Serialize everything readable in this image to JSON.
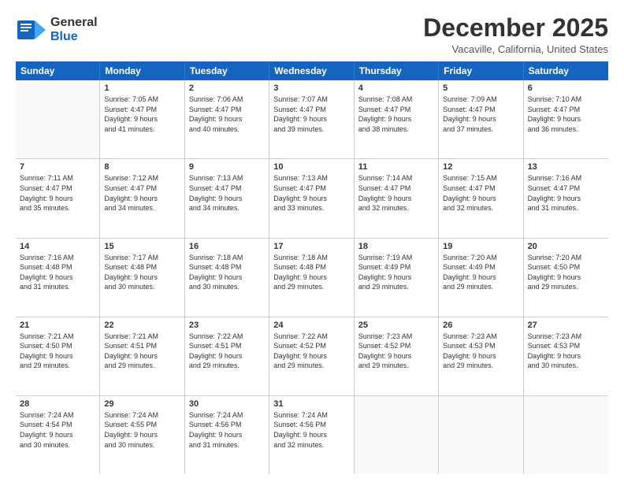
{
  "header": {
    "logo_line1": "General",
    "logo_line2": "Blue",
    "month": "December 2025",
    "location": "Vacaville, California, United States"
  },
  "weekdays": [
    "Sunday",
    "Monday",
    "Tuesday",
    "Wednesday",
    "Thursday",
    "Friday",
    "Saturday"
  ],
  "rows": [
    [
      {
        "day": "",
        "info": ""
      },
      {
        "day": "1",
        "info": "Sunrise: 7:05 AM\nSunset: 4:47 PM\nDaylight: 9 hours\nand 41 minutes."
      },
      {
        "day": "2",
        "info": "Sunrise: 7:06 AM\nSunset: 4:47 PM\nDaylight: 9 hours\nand 40 minutes."
      },
      {
        "day": "3",
        "info": "Sunrise: 7:07 AM\nSunset: 4:47 PM\nDaylight: 9 hours\nand 39 minutes."
      },
      {
        "day": "4",
        "info": "Sunrise: 7:08 AM\nSunset: 4:47 PM\nDaylight: 9 hours\nand 38 minutes."
      },
      {
        "day": "5",
        "info": "Sunrise: 7:09 AM\nSunset: 4:47 PM\nDaylight: 9 hours\nand 37 minutes."
      },
      {
        "day": "6",
        "info": "Sunrise: 7:10 AM\nSunset: 4:47 PM\nDaylight: 9 hours\nand 36 minutes."
      }
    ],
    [
      {
        "day": "7",
        "info": "Sunrise: 7:11 AM\nSunset: 4:47 PM\nDaylight: 9 hours\nand 35 minutes."
      },
      {
        "day": "8",
        "info": "Sunrise: 7:12 AM\nSunset: 4:47 PM\nDaylight: 9 hours\nand 34 minutes."
      },
      {
        "day": "9",
        "info": "Sunrise: 7:13 AM\nSunset: 4:47 PM\nDaylight: 9 hours\nand 34 minutes."
      },
      {
        "day": "10",
        "info": "Sunrise: 7:13 AM\nSunset: 4:47 PM\nDaylight: 9 hours\nand 33 minutes."
      },
      {
        "day": "11",
        "info": "Sunrise: 7:14 AM\nSunset: 4:47 PM\nDaylight: 9 hours\nand 32 minutes."
      },
      {
        "day": "12",
        "info": "Sunrise: 7:15 AM\nSunset: 4:47 PM\nDaylight: 9 hours\nand 32 minutes."
      },
      {
        "day": "13",
        "info": "Sunrise: 7:16 AM\nSunset: 4:47 PM\nDaylight: 9 hours\nand 31 minutes."
      }
    ],
    [
      {
        "day": "14",
        "info": "Sunrise: 7:16 AM\nSunset: 4:48 PM\nDaylight: 9 hours\nand 31 minutes."
      },
      {
        "day": "15",
        "info": "Sunrise: 7:17 AM\nSunset: 4:48 PM\nDaylight: 9 hours\nand 30 minutes."
      },
      {
        "day": "16",
        "info": "Sunrise: 7:18 AM\nSunset: 4:48 PM\nDaylight: 9 hours\nand 30 minutes."
      },
      {
        "day": "17",
        "info": "Sunrise: 7:18 AM\nSunset: 4:48 PM\nDaylight: 9 hours\nand 29 minutes."
      },
      {
        "day": "18",
        "info": "Sunrise: 7:19 AM\nSunset: 4:49 PM\nDaylight: 9 hours\nand 29 minutes."
      },
      {
        "day": "19",
        "info": "Sunrise: 7:20 AM\nSunset: 4:49 PM\nDaylight: 9 hours\nand 29 minutes."
      },
      {
        "day": "20",
        "info": "Sunrise: 7:20 AM\nSunset: 4:50 PM\nDaylight: 9 hours\nand 29 minutes."
      }
    ],
    [
      {
        "day": "21",
        "info": "Sunrise: 7:21 AM\nSunset: 4:50 PM\nDaylight: 9 hours\nand 29 minutes."
      },
      {
        "day": "22",
        "info": "Sunrise: 7:21 AM\nSunset: 4:51 PM\nDaylight: 9 hours\nand 29 minutes."
      },
      {
        "day": "23",
        "info": "Sunrise: 7:22 AM\nSunset: 4:51 PM\nDaylight: 9 hours\nand 29 minutes."
      },
      {
        "day": "24",
        "info": "Sunrise: 7:22 AM\nSunset: 4:52 PM\nDaylight: 9 hours\nand 29 minutes."
      },
      {
        "day": "25",
        "info": "Sunrise: 7:23 AM\nSunset: 4:52 PM\nDaylight: 9 hours\nand 29 minutes."
      },
      {
        "day": "26",
        "info": "Sunrise: 7:23 AM\nSunset: 4:53 PM\nDaylight: 9 hours\nand 29 minutes."
      },
      {
        "day": "27",
        "info": "Sunrise: 7:23 AM\nSunset: 4:53 PM\nDaylight: 9 hours\nand 30 minutes."
      }
    ],
    [
      {
        "day": "28",
        "info": "Sunrise: 7:24 AM\nSunset: 4:54 PM\nDaylight: 9 hours\nand 30 minutes."
      },
      {
        "day": "29",
        "info": "Sunrise: 7:24 AM\nSunset: 4:55 PM\nDaylight: 9 hours\nand 30 minutes."
      },
      {
        "day": "30",
        "info": "Sunrise: 7:24 AM\nSunset: 4:56 PM\nDaylight: 9 hours\nand 31 minutes."
      },
      {
        "day": "31",
        "info": "Sunrise: 7:24 AM\nSunset: 4:56 PM\nDaylight: 9 hours\nand 32 minutes."
      },
      {
        "day": "",
        "info": ""
      },
      {
        "day": "",
        "info": ""
      },
      {
        "day": "",
        "info": ""
      }
    ]
  ]
}
